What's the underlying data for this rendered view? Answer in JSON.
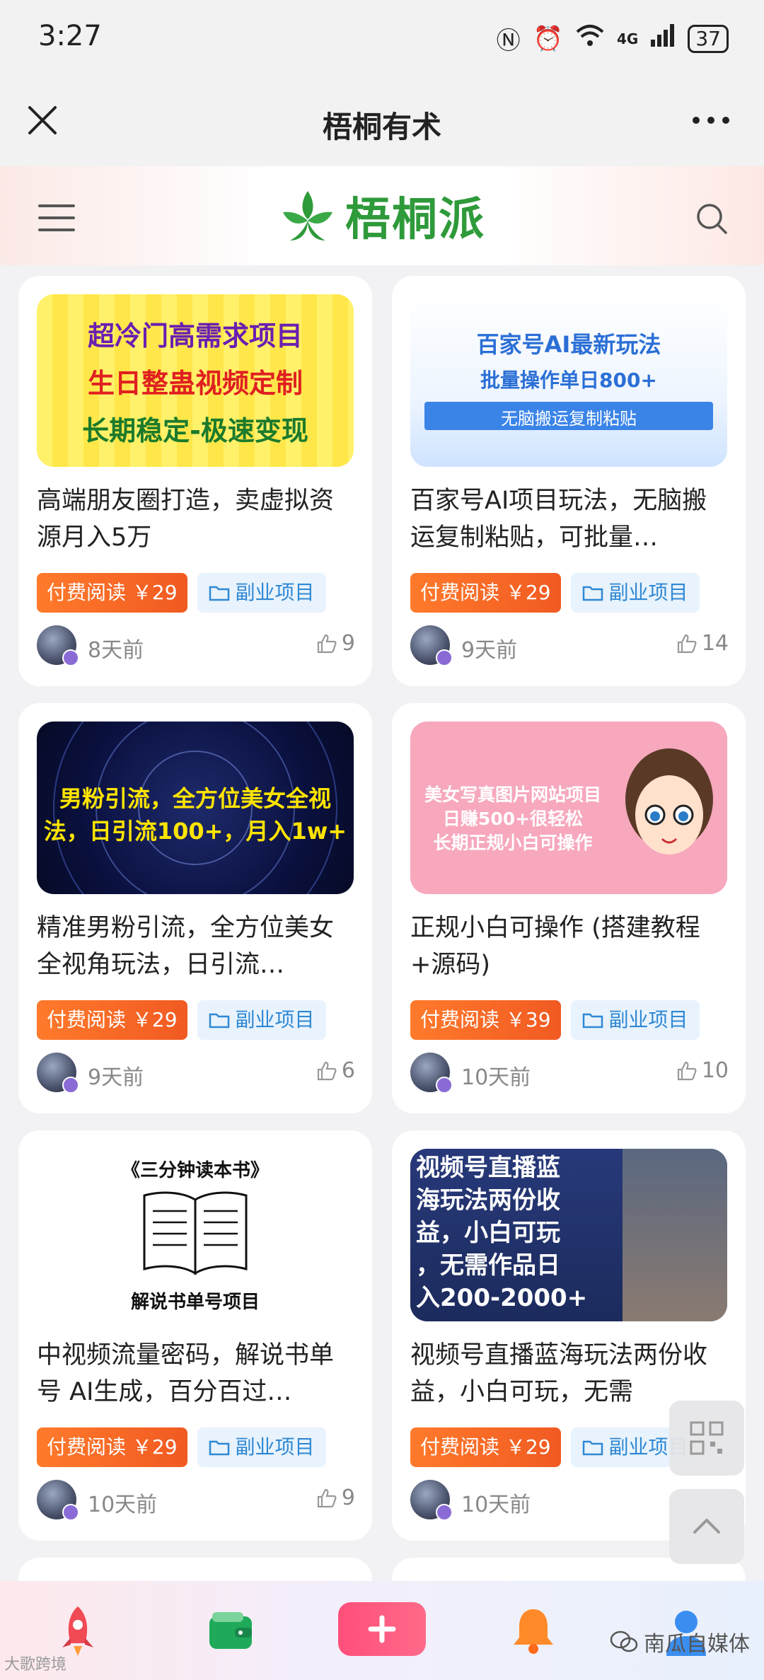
{
  "status_bar": {
    "time": "3:27",
    "network": "4G",
    "battery": "37"
  },
  "nav": {
    "title": "梧桐有术"
  },
  "site": {
    "brand": "梧桐派"
  },
  "cards": [
    {
      "thumb_lines": [
        "超冷门高需求项目",
        "生日整蛊视频定制",
        "长期稳定-极速变现"
      ],
      "title": "高端朋友圈打造，卖虚拟资源月入5万",
      "price_tag": "付费阅读 ￥29",
      "category": "副业项目",
      "time": "8天前",
      "likes": "9"
    },
    {
      "thumb_lines": [
        "百家号AI最新玩法",
        "批量操作单日800+",
        "无脑搬运复制粘贴"
      ],
      "title": "百家号AI项目玩法，无脑搬运复制粘贴，可批量…",
      "price_tag": "付费阅读 ￥29",
      "category": "副业项目",
      "time": "9天前",
      "likes": "14"
    },
    {
      "thumb_lines": [
        "男粉引流，全方位美女全视",
        "法，日引流100+，月入1w+"
      ],
      "title": "精准男粉引流，全方位美女全视角玩法，日引流…",
      "price_tag": "付费阅读 ￥29",
      "category": "副业项目",
      "time": "9天前",
      "likes": "6"
    },
    {
      "thumb_lines": [
        "美女写真图片网站项目",
        "日赚500+很轻松",
        "长期正规小白可操作"
      ],
      "title": "正规小白可操作 (搭建教程+源码)",
      "price_tag": "付费阅读 ￥39",
      "category": "副业项目",
      "time": "10天前",
      "likes": "10"
    },
    {
      "thumb_lines": [
        "《三分钟读本书》",
        "解说书单号项目"
      ],
      "title": "中视频流量密码，解说书单号 AI生成，百分百过…",
      "price_tag": "付费阅读 ￥29",
      "category": "副业项目",
      "time": "10天前",
      "likes": "9"
    },
    {
      "thumb_lines": [
        "视频号直播蓝",
        "海玩法两份收",
        "益，小白可玩",
        "，无需作品日",
        "入200-2000+"
      ],
      "title": "视频号直播蓝海玩法两份收益，小白可玩，无需",
      "price_tag": "付费阅读 ￥29",
      "category": "副业项目",
      "time": "10天前",
      "likes": ""
    }
  ],
  "watermarks": {
    "left": "大歌跨境",
    "right": "南瓜自媒体"
  },
  "colors": {
    "brand_green": "#2e9a3a",
    "price_orange": "#f15a22",
    "category_blue": "#2f88d4",
    "publish_pink": "#ff4f7a"
  },
  "icons": {
    "nav": [
      "close-icon",
      "more-icon"
    ],
    "header": [
      "menu-icon",
      "search-icon"
    ],
    "tabs": [
      "rocket-icon",
      "wallet-icon",
      "plus-icon",
      "bell-icon",
      "user-icon"
    ],
    "floating": [
      "qr-code-icon",
      "back-to-top-icon"
    ]
  }
}
